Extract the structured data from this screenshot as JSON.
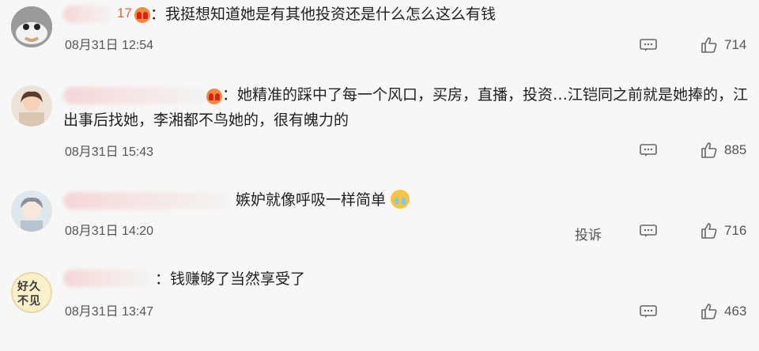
{
  "comments": [
    {
      "name_visible_suffix": "17",
      "text": "：我挺想知道她是有其他投资还是什么怎么这么有钱",
      "date": "08月31日 12:54",
      "likes": "714"
    },
    {
      "text_line1": "：她精准的踩中了每一个风口，买房，直播，投资…江铠同之前就是她捧的，江",
      "text_line2": "出事后找她，李湘都不鸟她的，很有魄力的",
      "date": "08月31日 15:43",
      "likes": "885"
    },
    {
      "text": "嫉妒就像呼吸一样简单",
      "date": "08月31日 14:20",
      "report": "投诉",
      "likes": "716"
    },
    {
      "avatar_text_top": "好久",
      "avatar_text_bottom": "不见",
      "text": "：钱赚够了当然享受了",
      "date": "08月31日 13:47",
      "likes": "463"
    }
  ],
  "colors": {
    "background": "#f7f7f7",
    "badge": "#f28b3f",
    "meta_text": "#555555"
  },
  "icons": [
    "comment-icon",
    "like-icon",
    "vip-badge-icon",
    "crying-emoji-icon"
  ]
}
